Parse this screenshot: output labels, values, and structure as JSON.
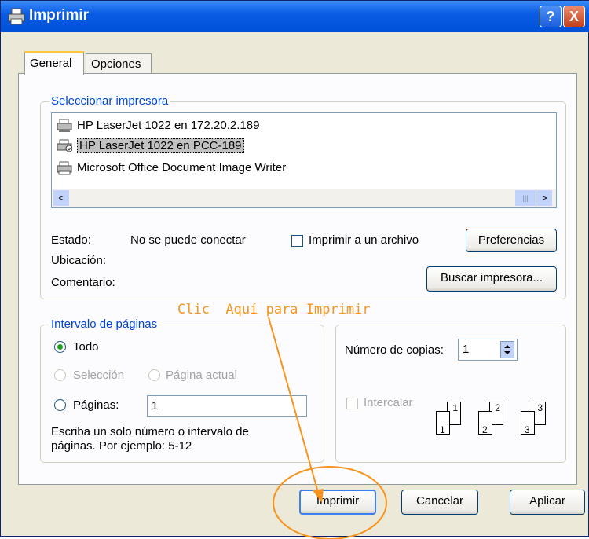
{
  "window": {
    "title": "Imprimir",
    "help_label": "?",
    "close_label": "X"
  },
  "tabs": [
    {
      "label": "General"
    },
    {
      "label": "Opciones"
    }
  ],
  "printer_group": {
    "legend": "Seleccionar impresora",
    "printers": [
      {
        "label": "HP LaserJet 1022 en 172.20.2.189"
      },
      {
        "label": "HP LaserJet 1022 en PCC-189"
      },
      {
        "label": "Microsoft Office Document Image Writer"
      }
    ],
    "selected_index": 1,
    "scroll_left": "<",
    "scroll_right": ">",
    "scroll_grip": "|||",
    "status_label": "Estado:",
    "status_value": "No se puede conectar",
    "location_label": "Ubicación:",
    "comment_label": "Comentario:",
    "print_to_file_label": "Imprimir a un archivo",
    "preferences_label": "Preferencias",
    "find_printer_label": "Buscar impresora..."
  },
  "range_group": {
    "legend": "Intervalo de páginas",
    "all_label": "Todo",
    "selection_label": "Selección",
    "current_page_label": "Página actual",
    "pages_label": "Páginas:",
    "pages_value": "1",
    "hint": "Escriba un solo número o intervalo de páginas. Por ejemplo: 5-12"
  },
  "copies_group": {
    "copies_label": "Número de copias:",
    "copies_value": "1",
    "collate_label": "Intercalar",
    "collate_pages": [
      "1",
      "1",
      "2",
      "2",
      "3",
      "3"
    ]
  },
  "buttons": {
    "print": "Imprimir",
    "cancel": "Cancelar",
    "apply": "Aplicar"
  },
  "annotation": {
    "text": "Clic  Aquí para Imprimir",
    "color": "#f7941d"
  }
}
